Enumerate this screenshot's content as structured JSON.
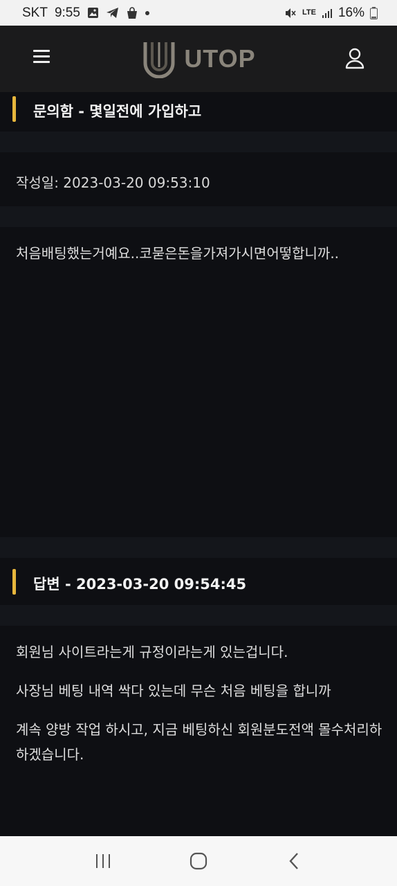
{
  "status_bar": {
    "carrier": "SKT",
    "time": "9:55",
    "network": "LTE",
    "battery": "16%"
  },
  "header": {
    "logo_text": "UTOP"
  },
  "inquiry": {
    "title": "문의함 - 몇일전에 가입하고",
    "date_label": "작성일: 2023-03-20 09:53:10",
    "content": "처음배팅했는거예요..코묻은돈을가져가시면어떻합니까.."
  },
  "answer": {
    "title": "답변 - 2023-03-20 09:54:45",
    "paragraphs": [
      "회원님 사이트라는게 규정이라는게 있는겁니다.",
      "사장님 베팅 내역 싹다 있는데 무슨 처음 베팅을 합니까",
      "계속 양방 작업 하시고, 지금 베팅하신 회원분도전액 몰수처리하하겠습니다."
    ]
  },
  "colors": {
    "accent": "#e7b63c",
    "background": "#14161b",
    "panel": "#0e0f13"
  }
}
